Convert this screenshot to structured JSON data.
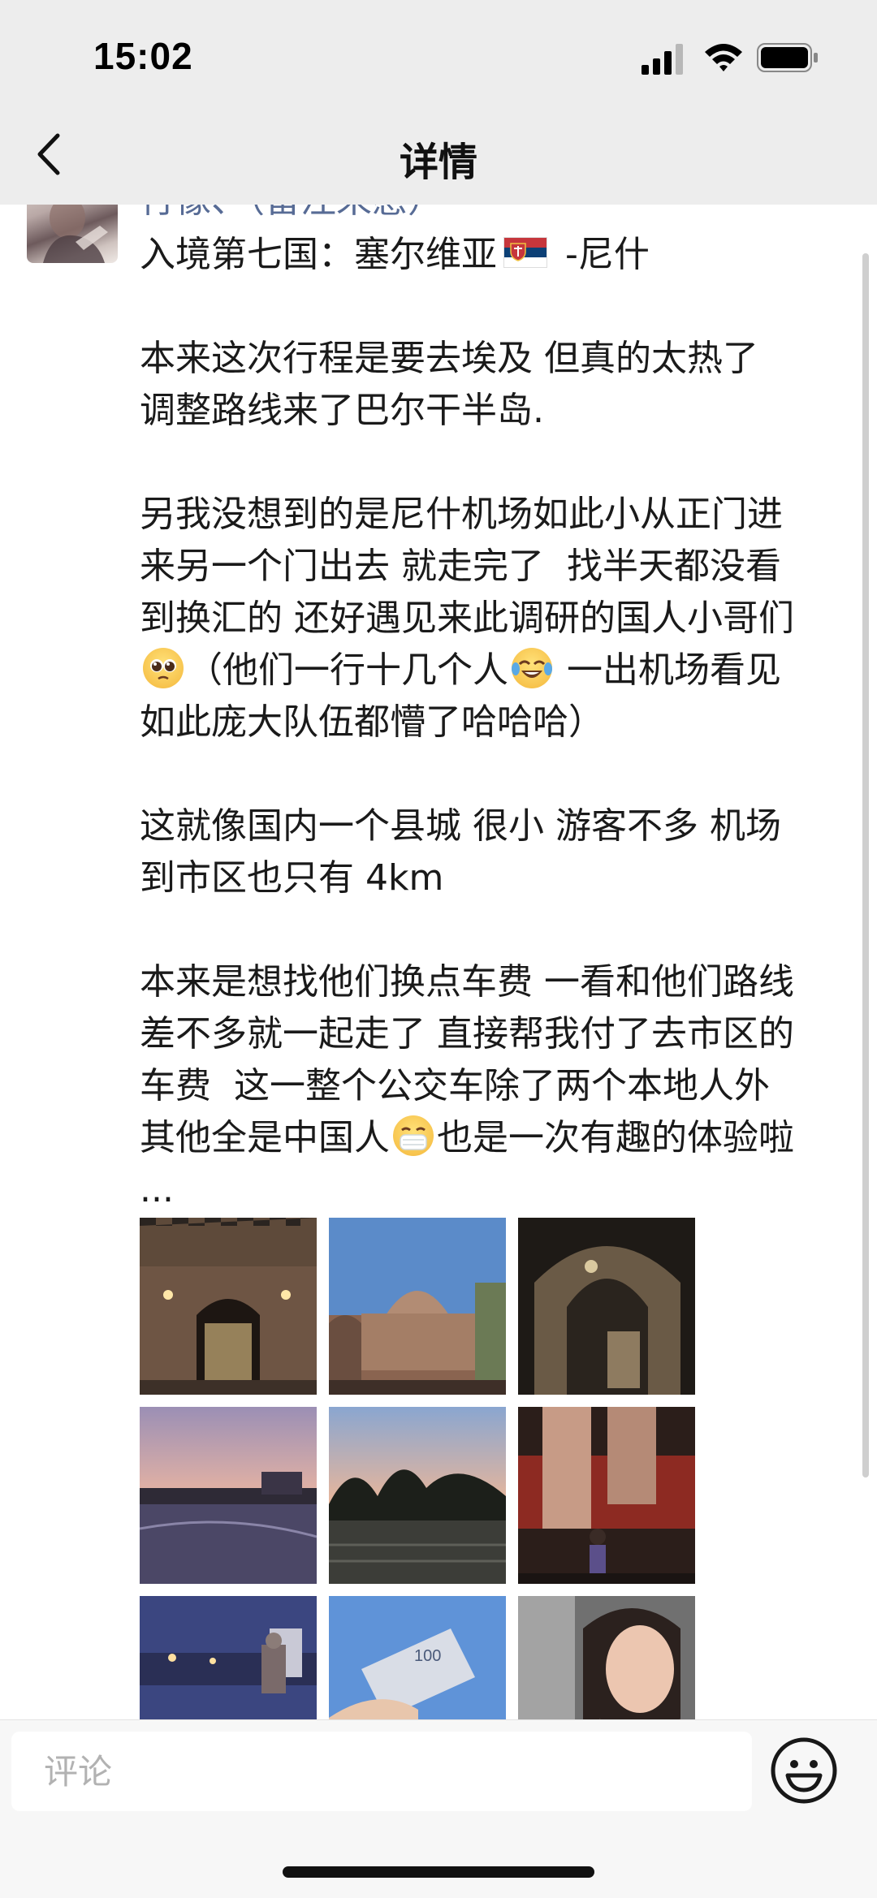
{
  "status_bar": {
    "time": "15:02"
  },
  "nav": {
    "title": "详情"
  },
  "post": {
    "nickname": "行像、（留注来感）",
    "paragraphs": {
      "p1a": "入境第七国：塞尔维亚",
      "p1b": " -尼什",
      "p2": "本来这次行程是要去埃及 但真的太热了\n调整路线来了巴尔干半岛.",
      "p3a": "另我没想到的是尼什机场如此小从正门进\n来另一个门出去 就走完了  找半天都没看\n到换汇的 还好遇见来此调研的国人小哥们\n",
      "p3b": "（他们一行十几个人",
      "p3c": " 一出机场看见\n如此庞大队伍都懵了哈哈哈）",
      "p4": "这就像国内一个县城 很小 游客不多 机场\n到市区也只有 4km",
      "p5a": "本来是想找他们换点车费 一看和他们路线\n差不多就一起走了 直接帮我付了去市区的\n车费  这一整个公交车除了两个本地人外\n其他全是中国人",
      "p5b": "也是一次有趣的体验啦\n..."
    },
    "emojis": {
      "flag": "serbia-flag-icon",
      "e1": "pleading-face-emoji",
      "e2": "tears-of-joy-emoji",
      "e3": "medical-mask-emoji"
    },
    "photos": [
      "fortress-gate-night-photo",
      "domed-building-dusk-photo",
      "stone-arch-night-photo",
      "river-sunset-photo",
      "park-steps-dusk-photo",
      "statue-person-photo",
      "river-city-night-photo",
      "banknote-hand-photo",
      "selfie-photo"
    ]
  },
  "comment_bar": {
    "placeholder": "评论"
  },
  "colors": {
    "nav_bg": "#ededed",
    "nickname": "#576b95",
    "text": "#1a1a1a"
  }
}
